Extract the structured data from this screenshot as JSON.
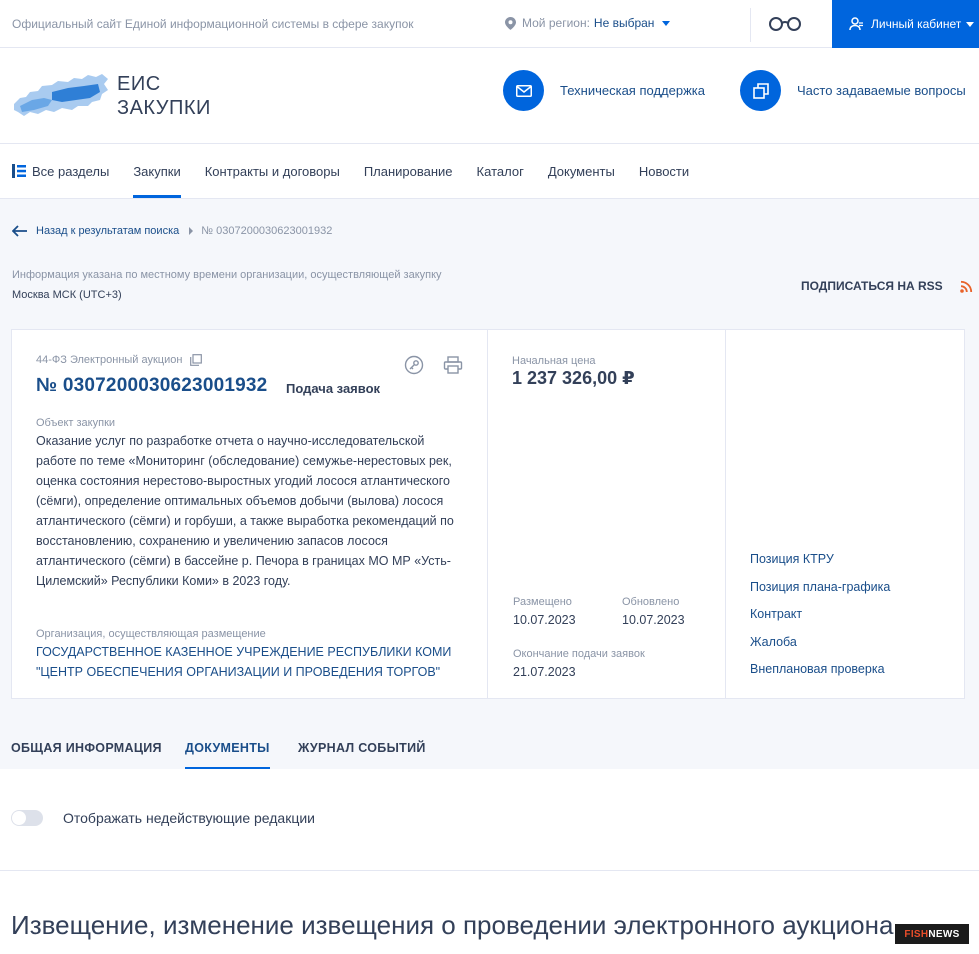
{
  "topbar": {
    "official_text": "Официальный сайт Единой информационной системы в сфере закупок",
    "region_label": "Мой регион:",
    "region_value": "Не выбран",
    "cabinet_label": "Личный кабинет"
  },
  "header": {
    "logo_line1": "ЕИС",
    "logo_line2": "ЗАКУПКИ",
    "support_label": "Техническая поддержка",
    "faq_label": "Часто задаваемые вопросы"
  },
  "nav": {
    "items": [
      "Все разделы",
      "Закупки",
      "Контракты и договоры",
      "Планирование",
      "Каталог",
      "Документы",
      "Новости"
    ],
    "active_index": 1
  },
  "breadcrumb": {
    "back_label": "Назад к результатам поиска",
    "current": "№ 0307200030623001932"
  },
  "timezone": {
    "info": "Информация указана по местному времени организации, осуществляющей закупку",
    "value": "Москва МСК (UTC+3)"
  },
  "rss_label": "ПОДПИСАТЬСЯ НА RSS",
  "purchase": {
    "type": "44-ФЗ Электронный аукцион",
    "number": "№ 0307200030623001932",
    "status": "Подача заявок",
    "object_label": "Объект закупки",
    "object_text": "Оказание услуг по разработке отчета о научно-исследовательской работе по теме «Мониторинг (обследование) семужье-нерестовых рек, оценка состояния нерестово-выростных угодий лосося атлантического (сёмги), определение оптимальных объемов добычи (вылова) лосося атлантического (сёмги) и горбуши, а также выработка рекомендаций по восстановлению, сохранению и увеличению запасов лосося атлантического (сёмги) в бассейне р. Печора в границах МО МР «Усть-Цилемский» Республики Коми» в 2023 году.",
    "org_label": "Организация, осуществляющая размещение",
    "org_name": "ГОСУДАРСТВЕННОЕ КАЗЕННОЕ УЧРЕЖДЕНИЕ РЕСПУБЛИКИ КОМИ \"ЦЕНТР ОБЕСПЕЧЕНИЯ ОРГАНИЗАЦИИ И ПРОВЕДЕНИЯ ТОРГОВ\"",
    "price_label": "Начальная цена",
    "price": "1 237 326,00 ₽",
    "placed_label": "Размещено",
    "placed_date": "10.07.2023",
    "updated_label": "Обновлено",
    "updated_date": "10.07.2023",
    "deadline_label": "Окончание подачи заявок",
    "deadline_date": "21.07.2023",
    "links": [
      "Позиция КТРУ",
      "Позиция плана-графика",
      "Контракт",
      "Жалоба",
      "Внеплановая проверка"
    ]
  },
  "tabs": {
    "items": [
      "ОБЩАЯ ИНФОРМАЦИЯ",
      "ДОКУМЕНТЫ",
      "ЖУРНАЛ СОБЫТИЙ"
    ],
    "active_index": 1
  },
  "toggle_label": "Отображать недействующие редакции",
  "notice_title": "Извещение, изменение извещения о проведении электронного аукциона",
  "watermark": {
    "part1": "FISH",
    "part2": "NEWS"
  },
  "colors": {
    "accent": "#0065dd",
    "link": "#1a4e8a",
    "text": "#334059",
    "muted": "#8a94a6",
    "rss": "#e8632a"
  }
}
